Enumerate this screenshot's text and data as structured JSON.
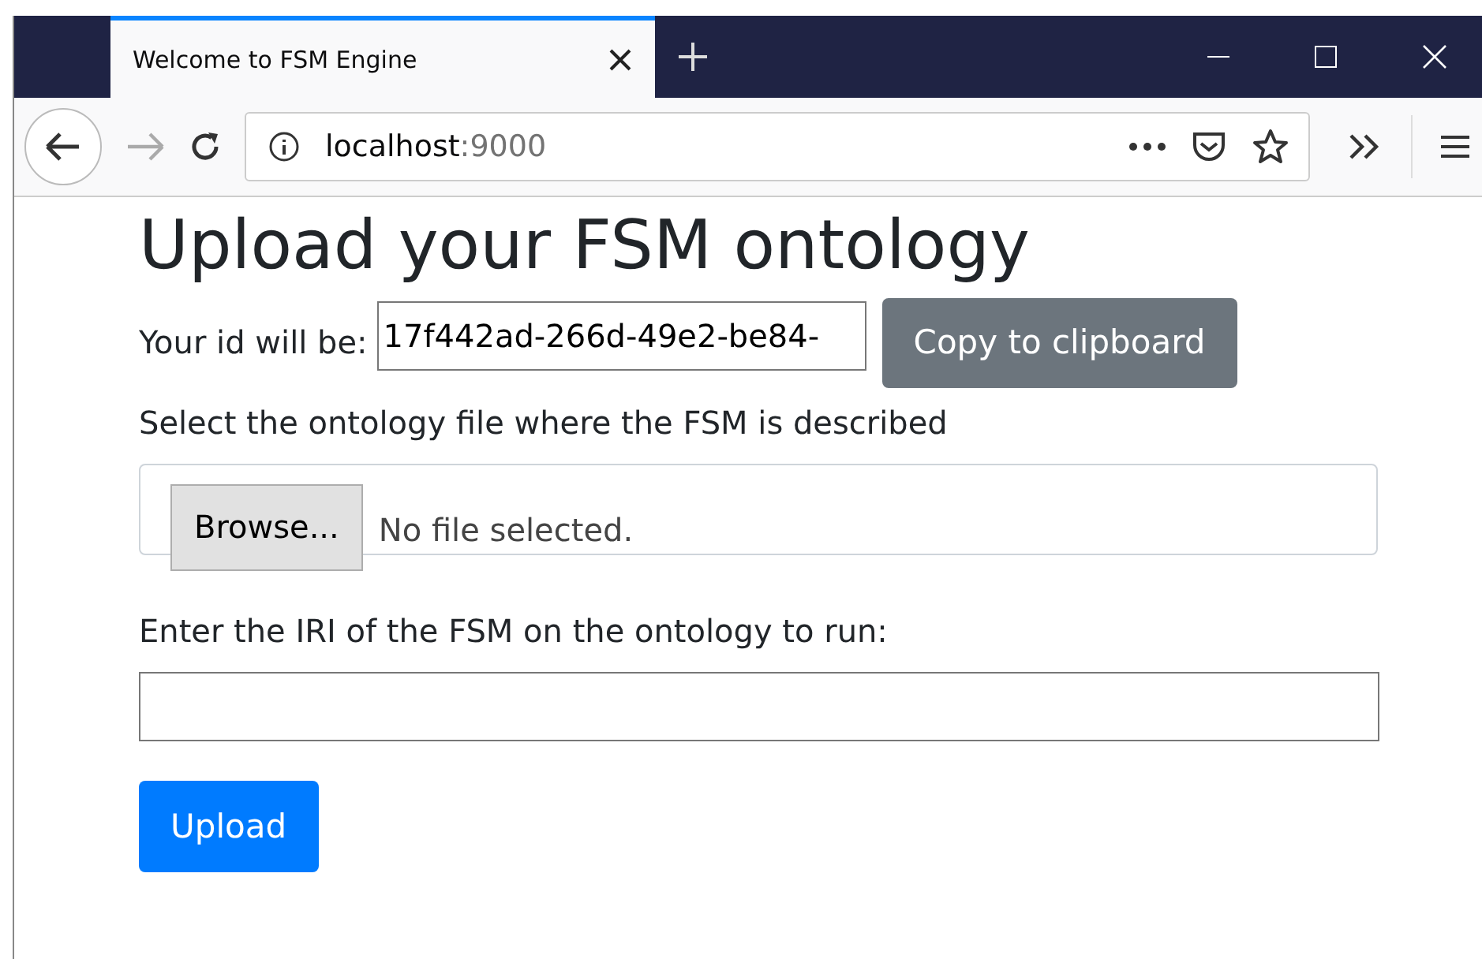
{
  "browser": {
    "tabs": [
      {
        "title": "Welcome to FSM Engine",
        "selected": true
      }
    ],
    "address": {
      "host": "localhost",
      "port": ":9000"
    }
  },
  "page": {
    "heading": "Upload your FSM ontology",
    "id_label": "Your id will be:",
    "id_value": "17f442ad-266d-49e2-be84-",
    "copy_button": "Copy to clipboard",
    "file_label": "Select the ontology file where the FSM is described",
    "browse_button": "Browse...",
    "file_status": "No file selected.",
    "iri_label": "Enter the IRI of the FSM on the ontology to run:",
    "upload_button": "Upload"
  }
}
